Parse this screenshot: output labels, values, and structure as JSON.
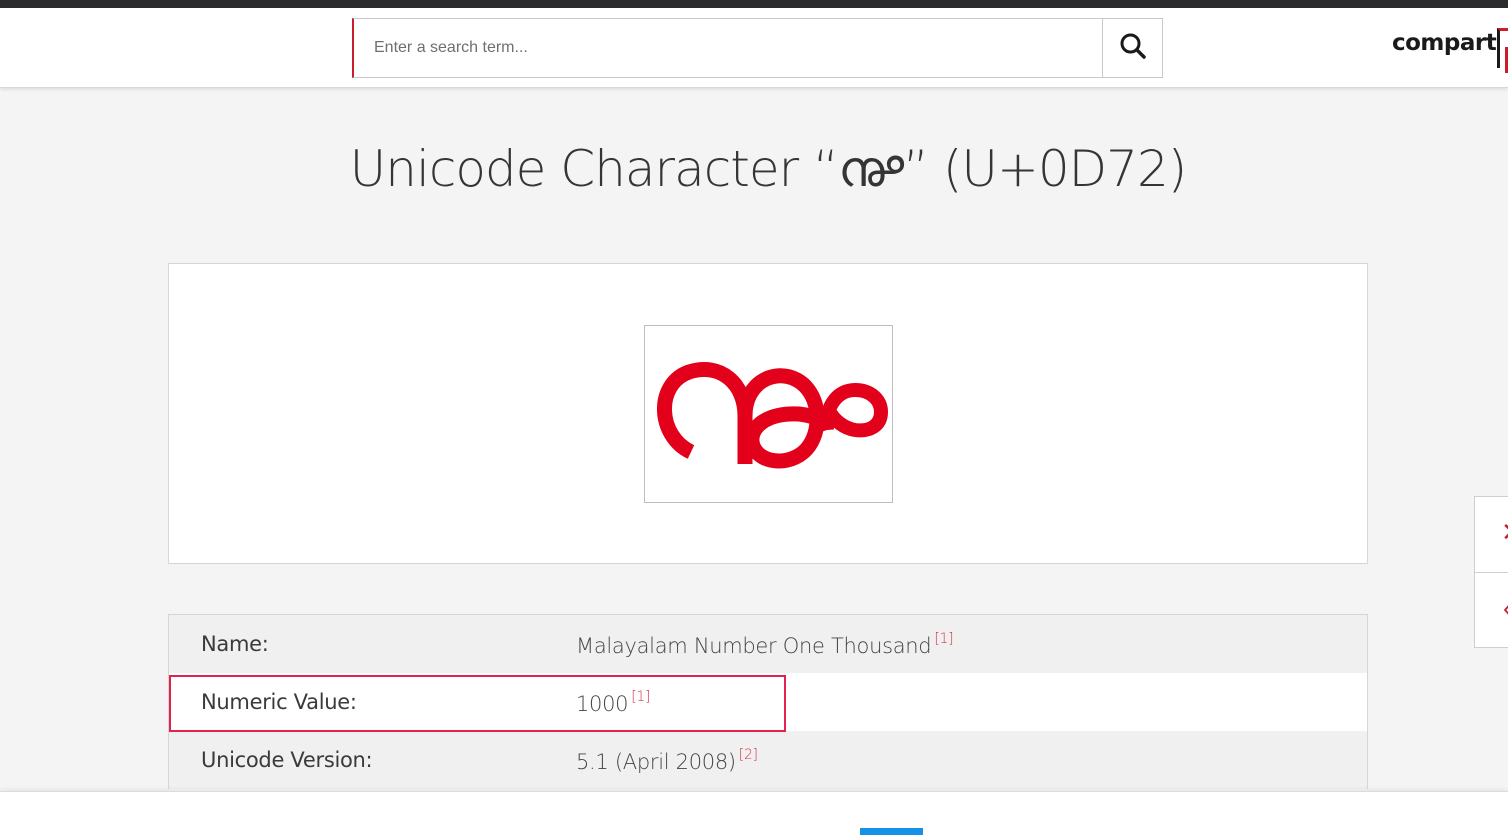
{
  "header": {
    "search": {
      "placeholder": "Enter a search term...",
      "value": ""
    },
    "logo_text": "compart",
    "brand_color": "#cc1c2c"
  },
  "page": {
    "title_prefix": "Unicode Character “",
    "title_char": "൲",
    "title_suffix": "” (U+0D72)"
  },
  "glyph_card": {
    "glyph": "൲",
    "glyph_color": "#e2001a"
  },
  "properties": [
    {
      "key": "Name:",
      "value": "Malayalam Number One Thousand",
      "ref": "[1]"
    },
    {
      "key": "Numeric Value:",
      "value": "1000",
      "ref": "[1]"
    },
    {
      "key": "Unicode Version:",
      "value": "5.1 (April 2008)",
      "ref": "[2]"
    }
  ],
  "colors": {
    "highlight": "#e3234d",
    "bottom_accent": "#1592e6"
  }
}
